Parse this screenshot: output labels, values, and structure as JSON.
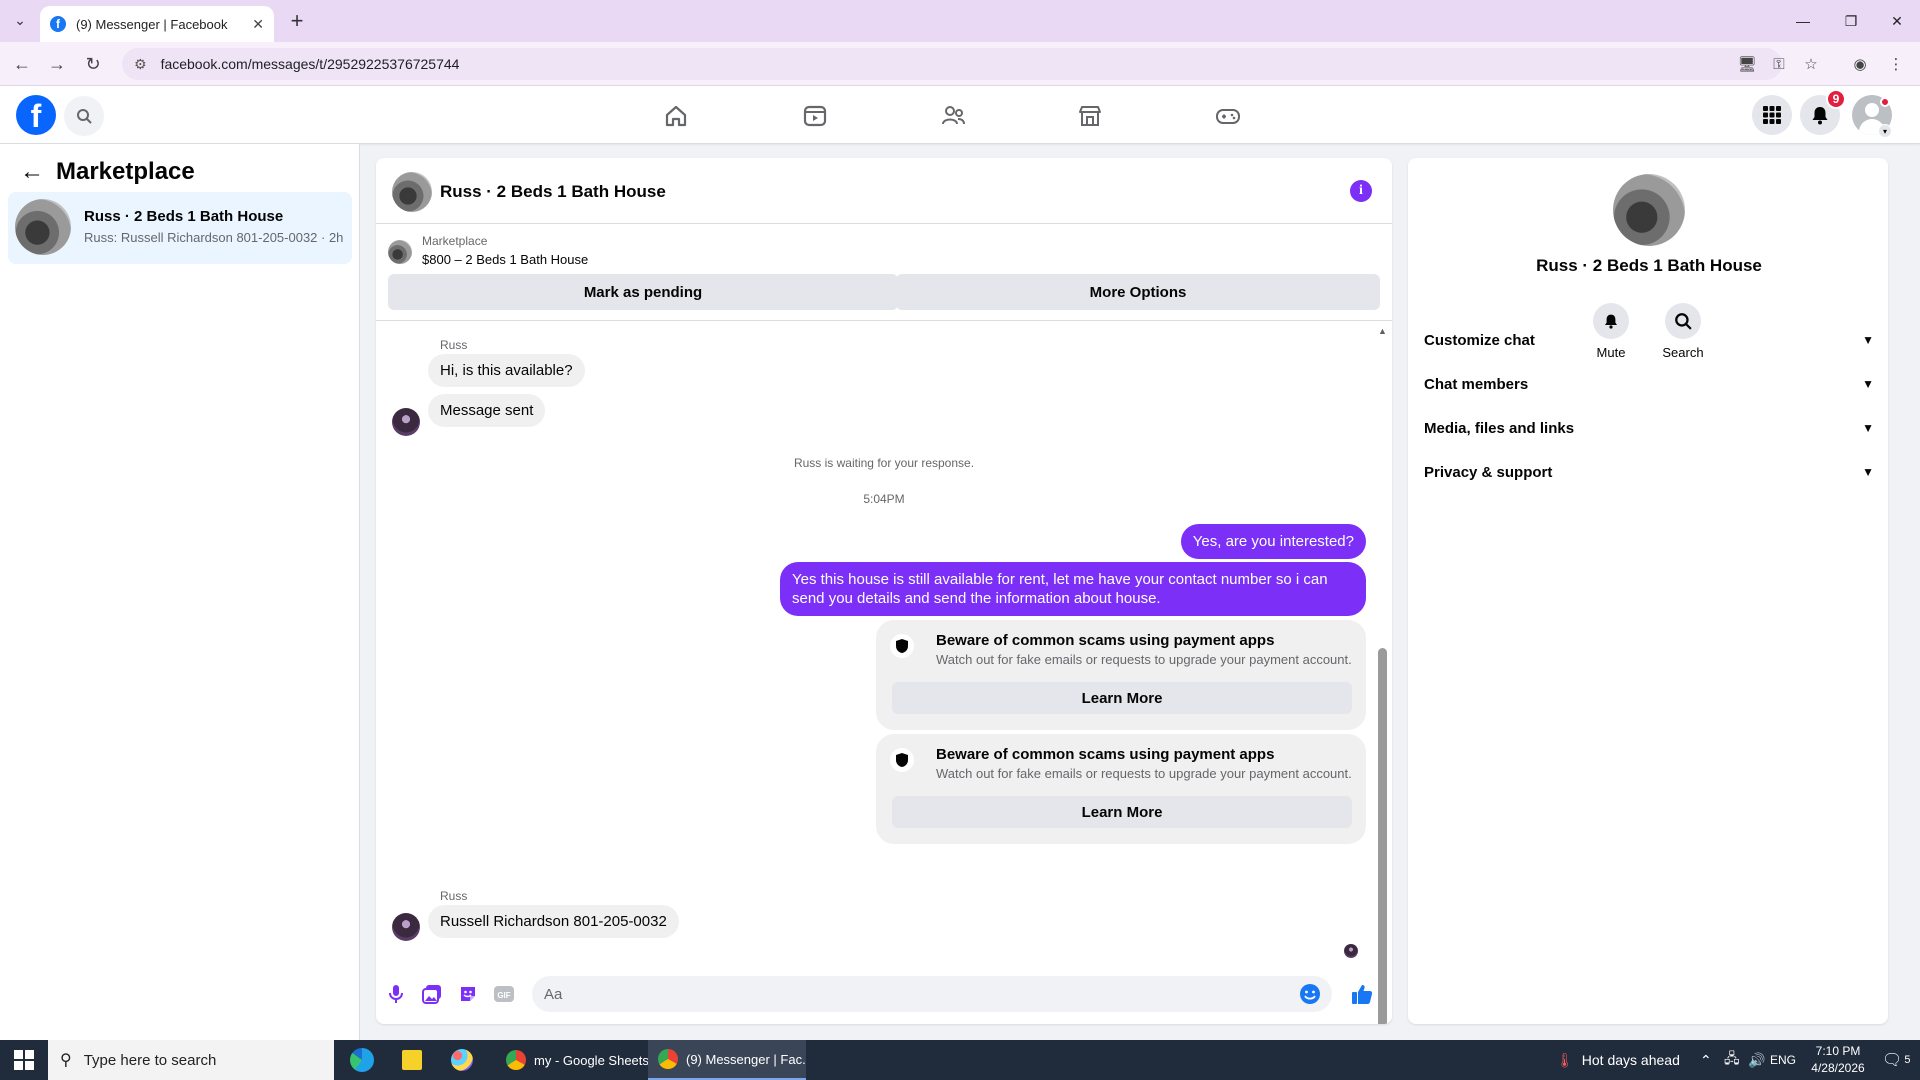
{
  "browser": {
    "tab_title": "(9) Messenger | Facebook",
    "url": "facebook.com/messages/t/29529225376725744"
  },
  "fb_header": {
    "notification_count": "9"
  },
  "left_pane": {
    "title": "Marketplace",
    "conversation": {
      "title": "Russ · 2 Beds 1 Bath House",
      "preview": "Russ: Russell Richardson 801-205-0032 · 2h"
    }
  },
  "chat": {
    "title": "Russ · 2 Beds 1 Bath House",
    "listing_label": "Marketplace",
    "listing_price": "$800 – 2 Beds 1 Bath House",
    "mark_pending": "Mark as pending",
    "more_options": "More Options",
    "messages": {
      "sender_1": "Russ",
      "msg_1": "Hi, is this available?",
      "msg_2": "Message sent",
      "waiting_note": "Russ is waiting for your response.",
      "timestamp": "5:04PM",
      "out_1": "Yes, are you interested?",
      "out_2": "Yes this house is still available for rent, let me have your contact number so i can send you details and send the information about house.",
      "scam_title": "Beware of common scams using payment apps",
      "scam_desc": "Watch out for fake emails or requests to upgrade your payment account.",
      "learn_more": "Learn More",
      "sender_2": "Russ",
      "msg_3": "Russell Richardson 801-205-0032"
    },
    "composer_placeholder": "Aa",
    "accent_color": "#7b2ff7"
  },
  "right_pane": {
    "name": "Russ · 2 Beds 1 Bath House",
    "mute_label": "Mute",
    "search_label": "Search",
    "sections": [
      "Customize chat",
      "Chat members",
      "Media, files and links",
      "Privacy & support"
    ]
  },
  "taskbar": {
    "search_placeholder": "Type here to search",
    "win_1": "my - Google Sheets...",
    "win_2": "(9) Messenger | Fac...",
    "weather": "Hot days ahead",
    "lang": "ENG",
    "time": "7:10 PM",
    "date": "4/28/2026",
    "notif_count": "5"
  }
}
